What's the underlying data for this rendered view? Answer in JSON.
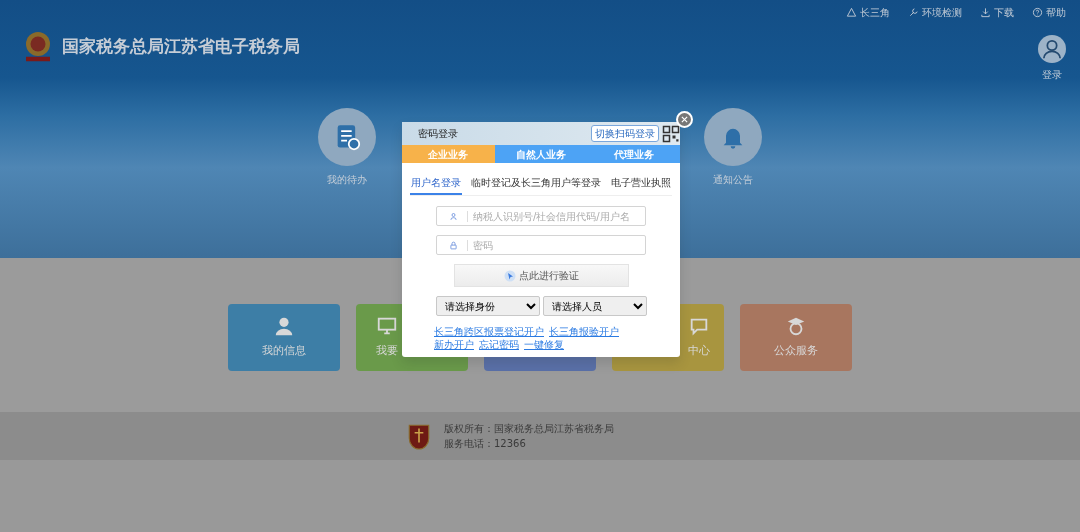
{
  "header": {
    "title": "国家税务总局江苏省电子税务局",
    "links": [
      {
        "kind": "triangle",
        "label": "长三角"
      },
      {
        "kind": "wrench",
        "label": "环境检测"
      },
      {
        "kind": "download",
        "label": "下载"
      },
      {
        "kind": "help",
        "label": "帮助"
      }
    ],
    "login": "登录"
  },
  "banner_items": [
    {
      "kind": "todo",
      "label": "我的待办"
    },
    {
      "kind": "bell",
      "label": "通知公告"
    }
  ],
  "tiles": [
    {
      "kind": "person",
      "label": "我的信息",
      "color": "#3d7ea6"
    },
    {
      "kind": "screen",
      "label": "我要",
      "color": "#6a9a4a"
    },
    {
      "kind": "none",
      "color": "#5a70a8"
    },
    {
      "kind": "chat",
      "label": "中心",
      "color": "#a8953f"
    },
    {
      "kind": "scholar",
      "label": "公众服务",
      "color": "#a8765f"
    }
  ],
  "footer": {
    "copyright": "版权所有：国家税务总局江苏省税务局",
    "phone": "服务电话：12366"
  },
  "dialog": {
    "title": "密码登录",
    "switch": "切换扫码登录",
    "tabs": [
      {
        "label": "企业业务",
        "selected": true
      },
      {
        "label": "自然人业务",
        "selected": false
      },
      {
        "label": "代理业务",
        "selected": false
      }
    ],
    "subtabs": [
      {
        "label": "用户名登录",
        "selected": true
      },
      {
        "label": "临时登记及长三角用户等登录",
        "selected": false
      },
      {
        "label": "电子营业执照",
        "selected": false
      }
    ],
    "fields": [
      {
        "kind": "user",
        "placeholder": "纳税人识别号/社会信用代码/用户名"
      },
      {
        "kind": "lock",
        "placeholder": "密码"
      }
    ],
    "verify": "点此进行验证",
    "selects": [
      {
        "value": "请选择身份"
      },
      {
        "value": "请选择人员"
      }
    ],
    "links": [
      "长三角跨区报票登记开户",
      "长三角报验开户",
      "新办开户",
      "忘记密码",
      "一键修复"
    ]
  }
}
